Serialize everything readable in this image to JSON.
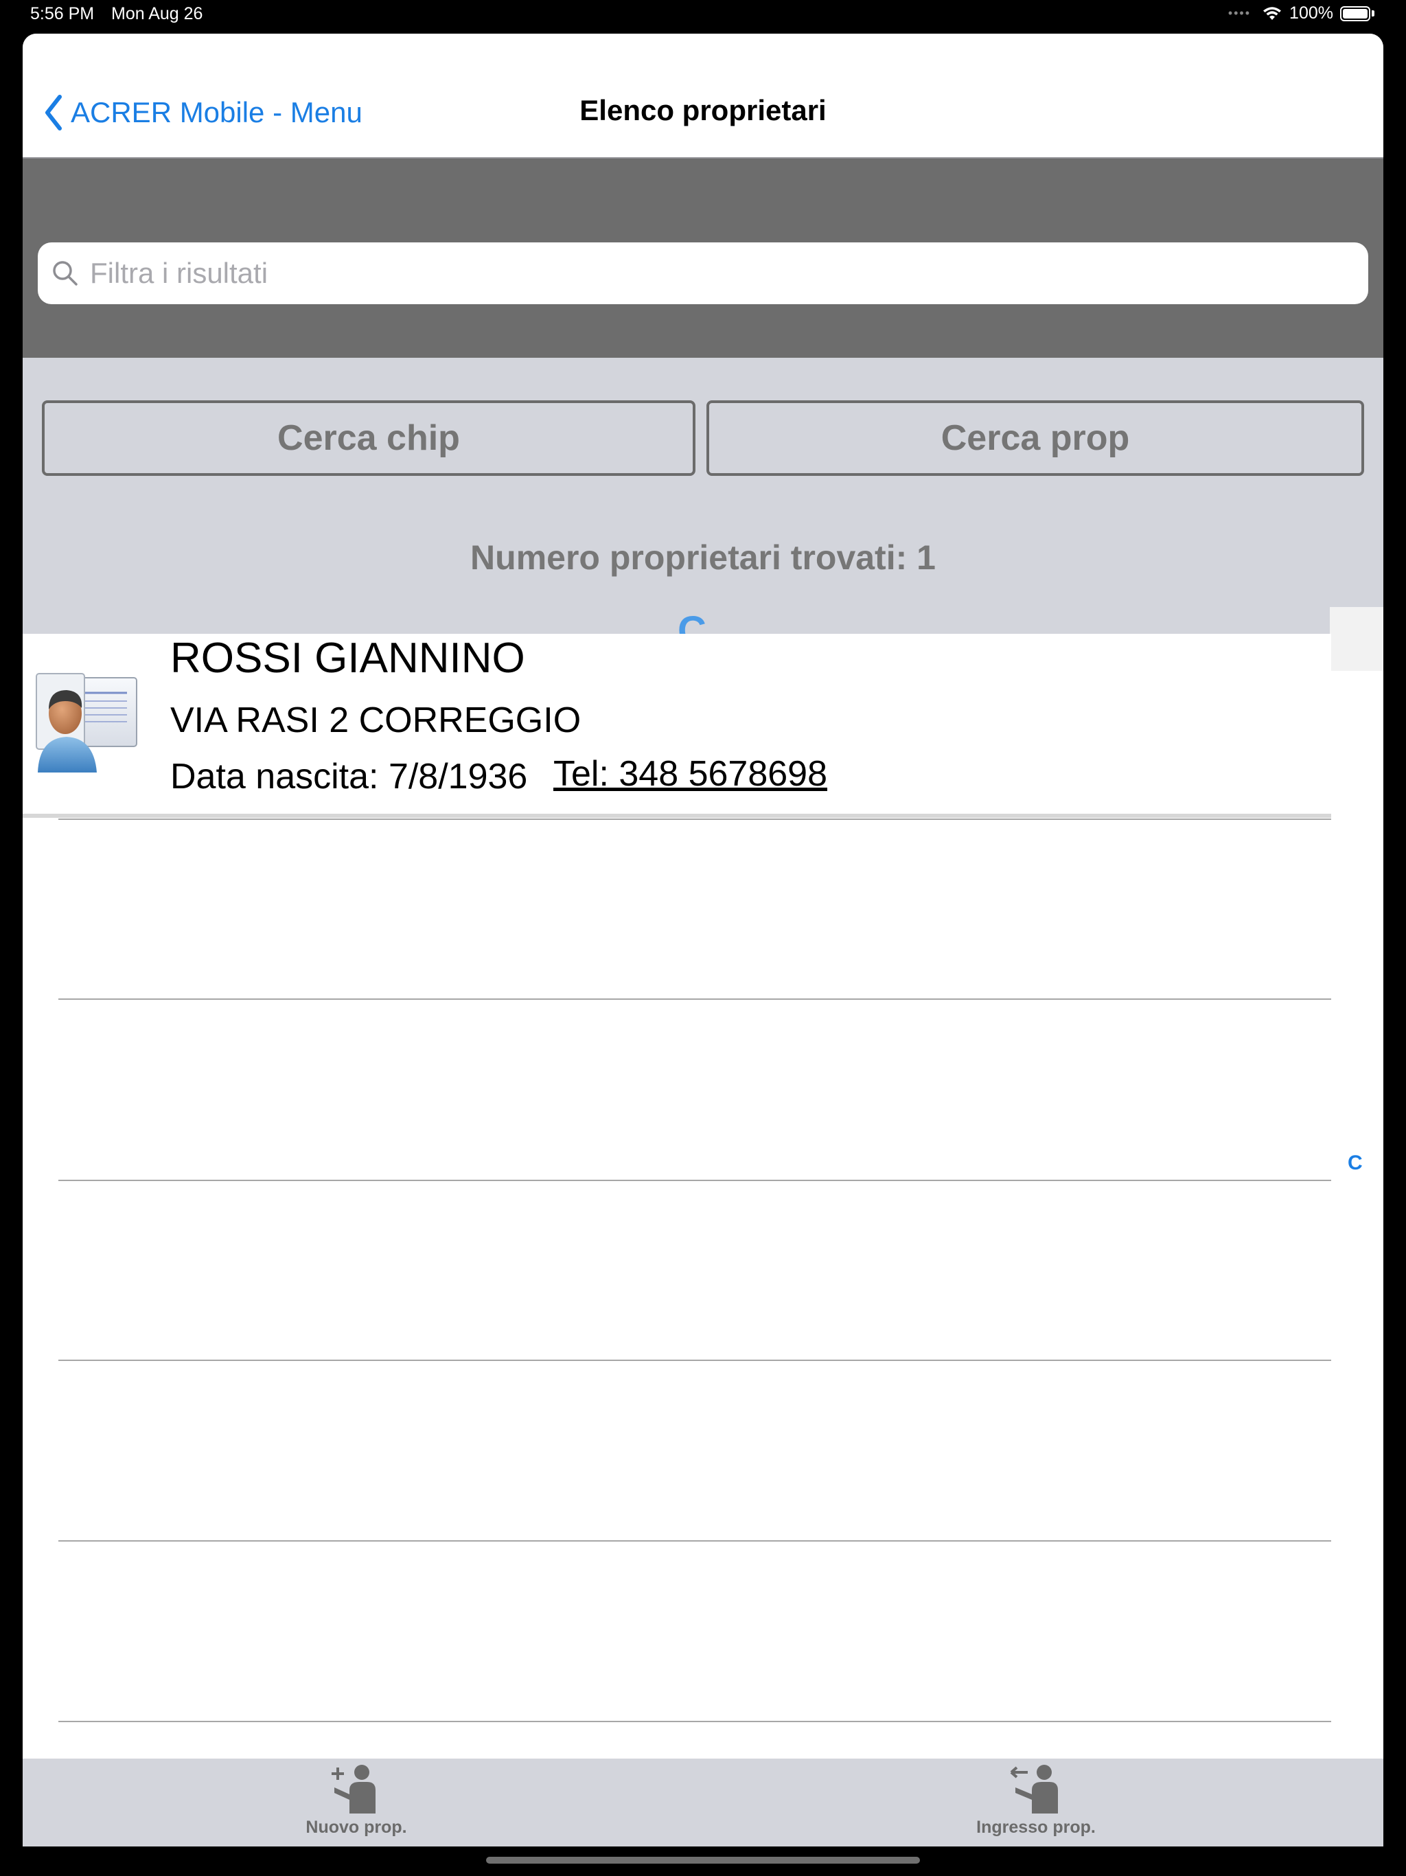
{
  "status": {
    "time": "5:56 PM",
    "date": "Mon Aug 26",
    "battery": "100%"
  },
  "nav": {
    "back_label": "ACRER Mobile - Menu",
    "title": "Elenco proprietari"
  },
  "search": {
    "placeholder": "Filtra i risultati",
    "value": ""
  },
  "filters": {
    "chip_button": "Cerca chip",
    "prop_button": "Cerca prop",
    "count_text": "Numero proprietari trovati: 1"
  },
  "section": {
    "letter": "C"
  },
  "owners": [
    {
      "name": "ROSSI GIANNINO",
      "address": "VIA RASI 2 CORREGGIO",
      "birth": "Data nascita: 7/8/1936",
      "phone": "Tel: 348 5678698"
    }
  ],
  "index": {
    "letters": [
      "C"
    ]
  },
  "tabbar": {
    "new_label": "Nuovo prop.",
    "entry_label": "Ingresso prop."
  },
  "colors": {
    "accent": "#1a7ee4",
    "section_letter": "#4a9be8",
    "panel": "#d3d5dc",
    "search_bg": "#6d6d6d"
  }
}
